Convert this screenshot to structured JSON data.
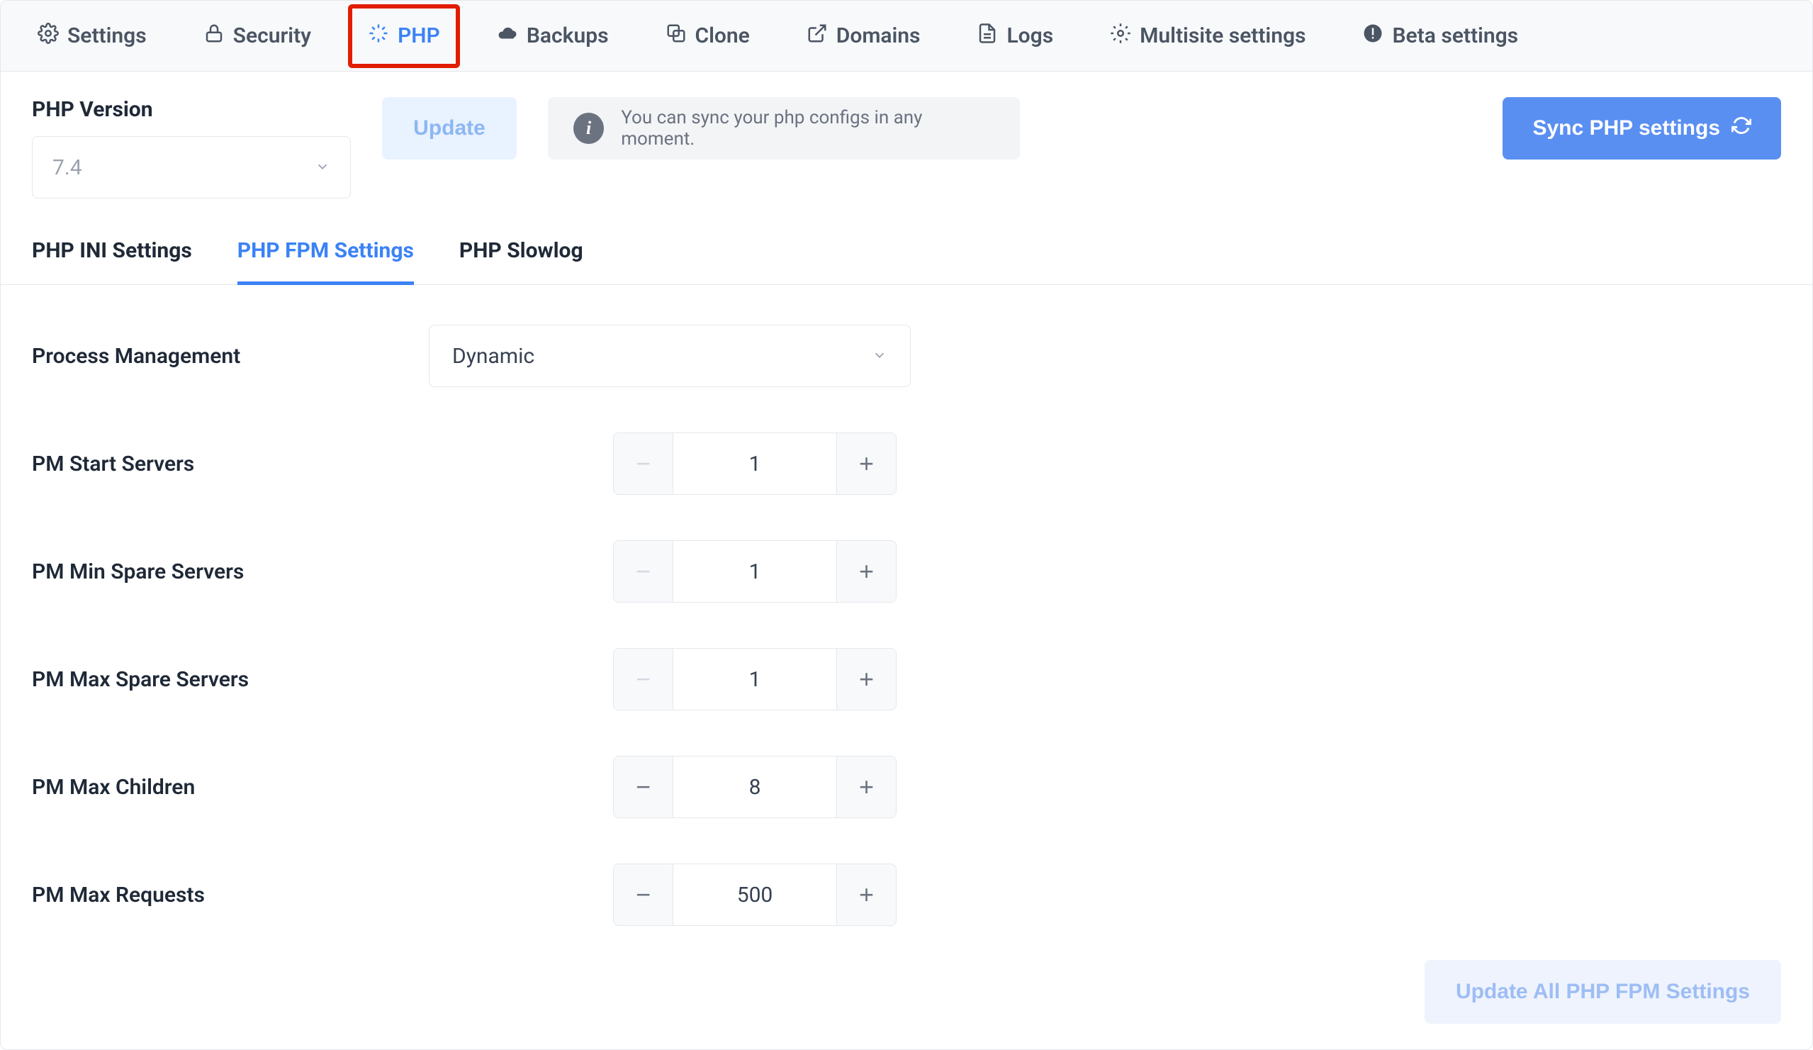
{
  "tabs": {
    "settings": {
      "label": "Settings"
    },
    "security": {
      "label": "Security"
    },
    "php": {
      "label": "PHP"
    },
    "backups": {
      "label": "Backups"
    },
    "clone": {
      "label": "Clone"
    },
    "domains": {
      "label": "Domains"
    },
    "logs": {
      "label": "Logs"
    },
    "multisite": {
      "label": "Multisite settings"
    },
    "beta": {
      "label": "Beta settings"
    }
  },
  "php_version": {
    "label": "PHP Version",
    "value": "7.4"
  },
  "buttons": {
    "update": "Update",
    "sync": "Sync PHP settings",
    "update_all": "Update All PHP FPM Settings"
  },
  "info_banner": "You can sync your php configs in any moment.",
  "subtabs": {
    "ini": "PHP INI Settings",
    "fpm": "PHP FPM Settings",
    "slowlog": "PHP Slowlog"
  },
  "process_management": {
    "label": "Process Management",
    "value": "Dynamic"
  },
  "fields": {
    "start_servers": {
      "label": "PM Start Servers",
      "value": "1",
      "dec_disabled": true
    },
    "min_spare_servers": {
      "label": "PM Min Spare Servers",
      "value": "1",
      "dec_disabled": true
    },
    "max_spare_servers": {
      "label": "PM Max Spare Servers",
      "value": "1",
      "dec_disabled": true
    },
    "max_children": {
      "label": "PM Max Children",
      "value": "8",
      "dec_disabled": false
    },
    "max_requests": {
      "label": "PM Max Requests",
      "value": "500",
      "dec_disabled": false
    }
  },
  "glyphs": {
    "minus": "−",
    "plus": "+"
  }
}
